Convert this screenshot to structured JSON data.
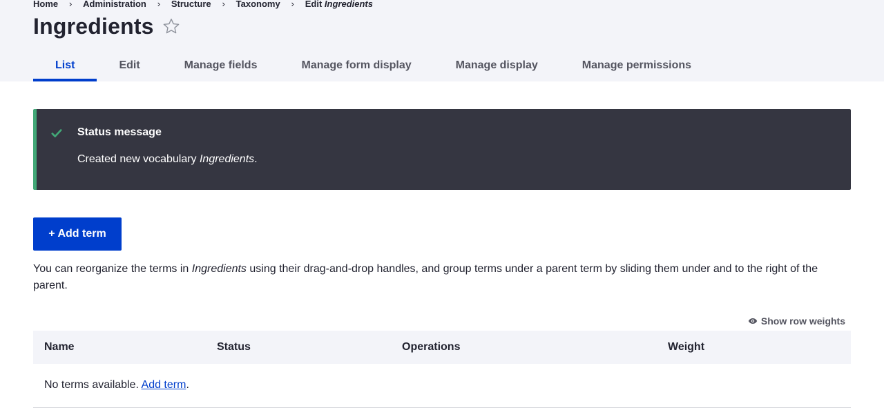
{
  "breadcrumb": {
    "items": [
      "Home",
      "Administration",
      "Structure",
      "Taxonomy"
    ],
    "current_prefix": "Edit",
    "current_name": "Ingredients"
  },
  "page": {
    "title": "Ingredients"
  },
  "tabs": [
    {
      "label": "List",
      "active": true
    },
    {
      "label": "Edit"
    },
    {
      "label": "Manage fields"
    },
    {
      "label": "Manage form display"
    },
    {
      "label": "Manage display"
    },
    {
      "label": "Manage permissions"
    }
  ],
  "status": {
    "title": "Status message",
    "text_before": "Created new vocabulary ",
    "vocabulary": "Ingredients",
    "text_after": "."
  },
  "actions": {
    "add_term_label": "+ Add term"
  },
  "help": {
    "before": "You can reorganize the terms in ",
    "vocabulary": "Ingredients",
    "after": " using their drag-and-drop handles, and group terms under a parent term by sliding them under and to the right of the parent."
  },
  "table": {
    "show_weights_label": "Show row weights",
    "columns": [
      "Name",
      "Status",
      "Operations",
      "Weight"
    ],
    "empty_text": "No terms available. ",
    "empty_link": "Add term",
    "empty_after": "."
  },
  "colors": {
    "accent": "#003ecc",
    "status_bg": "#353641",
    "status_success": "#42a877",
    "header_bg": "#f3f4f9"
  }
}
